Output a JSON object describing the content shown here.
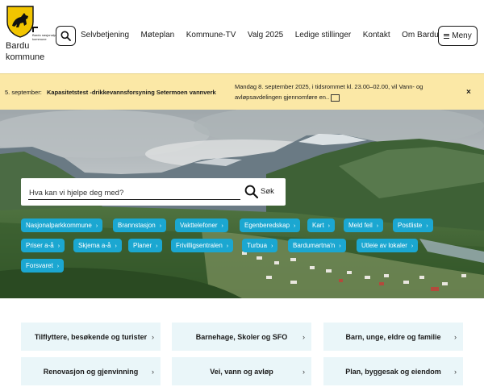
{
  "brand": {
    "name_line1": "Bardu",
    "name_line2": "kommune",
    "np_badge": "Bardu nasjonalpark-kommune",
    "crest_color": "#f2c500"
  },
  "header": {
    "nav": [
      "Selvbetjening",
      "Møteplan",
      "Kommune-TV",
      "Valg 2025",
      "Ledige stillinger",
      "Kontakt",
      "Om Bardu"
    ],
    "menu_label": "Meny"
  },
  "alert": {
    "date": "5. september:",
    "title": "Kapasitetstest -drikkevannsforsyning Setermoen vannverk",
    "body": "Mandag 8. september 2025, i tidsrommet kl. 23.00–02.00, vil Vann- og avløpsavdelingen gjennomføre en..",
    "close": "×",
    "bg_color": "#fbe8a6"
  },
  "search": {
    "placeholder": "Hva kan vi hjelpe deg med?",
    "submit_label": "Søk"
  },
  "quick_links": [
    "Nasjonalparkkommune",
    "Brannstasjon",
    "Vakttelefoner",
    "Egenberedskap",
    "Kart",
    "Meld feil",
    "Postliste",
    "Priser a-å",
    "Skjema a-å",
    "Planer",
    "Frivilligsentralen",
    "Turbua",
    "Bardumartna'n",
    "Utleie av lokaler",
    "Forsvaret"
  ],
  "chip_color": "#1ba7d1",
  "cards": [
    "Tilflyttere, besøkende og turister",
    "Barnehage, Skoler og SFO",
    "Barn, unge, eldre og familie",
    "Renovasjon og gjenvinning",
    "Vei, vann og avløp",
    "Plan, byggesak og eiendom"
  ],
  "card_bg": "#eaf6f9"
}
